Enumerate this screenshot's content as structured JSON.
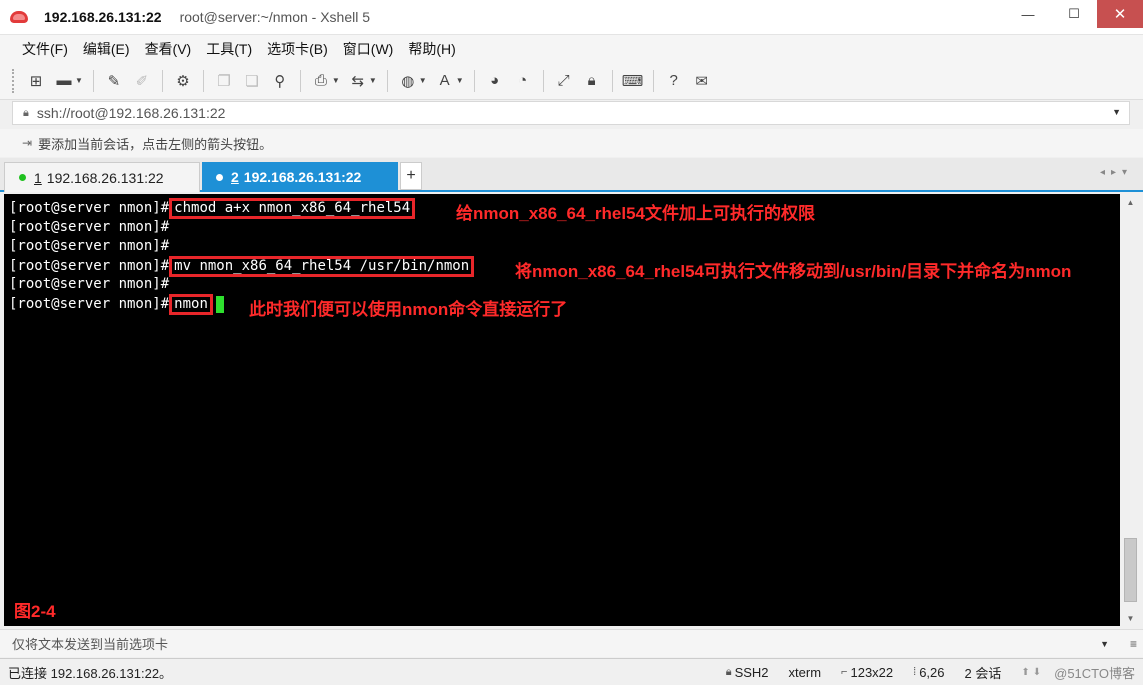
{
  "window": {
    "host": "192.168.26.131:22",
    "title_rest": "root@server:~/nmon - Xshell 5",
    "minimize": "—",
    "maximize": "☐",
    "close": "✕"
  },
  "menu": [
    {
      "label": "文件(F)"
    },
    {
      "label": "编辑(E)"
    },
    {
      "label": "查看(V)"
    },
    {
      "label": "工具(T)"
    },
    {
      "label": "选项卡(B)"
    },
    {
      "label": "窗口(W)"
    },
    {
      "label": "帮助(H)"
    }
  ],
  "toolbar": {
    "icons": [
      "new-session-icon",
      "open-folder-icon",
      "reconnect-icon",
      "disconnect-icon",
      "session-properties-icon",
      "copy-icon",
      "paste-icon",
      "find-icon",
      "print-icon",
      "transfer-icon",
      "globe-icon",
      "font-icon",
      "xftp-icon",
      "xmanager-icon",
      "fullscreen-icon",
      "lock-icon",
      "keyboard-icon",
      "help-icon",
      "chat-icon"
    ]
  },
  "address": {
    "value": "ssh://root@192.168.26.131:22"
  },
  "hint": {
    "text": "要添加当前会话，点击左侧的箭头按钮。"
  },
  "tabs": [
    {
      "num": "1",
      "label": "192.168.26.131:22",
      "active": false
    },
    {
      "num": "2",
      "label": "192.168.26.131:22",
      "active": true
    }
  ],
  "terminal": {
    "prompt": "[root@server nmon]#",
    "lines": [
      {
        "cmd": "chmod a+x nmon_x86_64_rhel54",
        "annotation": "给nmon_x86_64_rhel54文件加上可执行的权限"
      },
      {
        "cmd": "",
        "annotation": ""
      },
      {
        "cmd": "",
        "annotation": ""
      },
      {
        "cmd": "mv nmon_x86_64_rhel54 /usr/bin/nmon",
        "annotation": "将nmon_x86_64_rhel54可执行文件移动到/usr/bin/目录下并命名为nmon"
      },
      {
        "cmd": "",
        "annotation": ""
      },
      {
        "cmd": "nmon",
        "annotation": "此时我们便可以使用nmon命令直接运行了"
      }
    ],
    "figure_label": "图2-4",
    "cursor_color": "#2ee02e",
    "annotation_color": "#ff2a2a"
  },
  "sendbar": {
    "placeholder": "仅将文本发送到当前选项卡"
  },
  "status": {
    "connection": "已连接 192.168.26.131:22。",
    "protocol": "SSH2",
    "term": "xterm",
    "size": "123x22",
    "cursor_pos": "6,26",
    "sessions": "2 会话",
    "watermark": "@51CTO博客"
  },
  "colors": {
    "accent": "#1e90d6",
    "close": "#c75050"
  }
}
